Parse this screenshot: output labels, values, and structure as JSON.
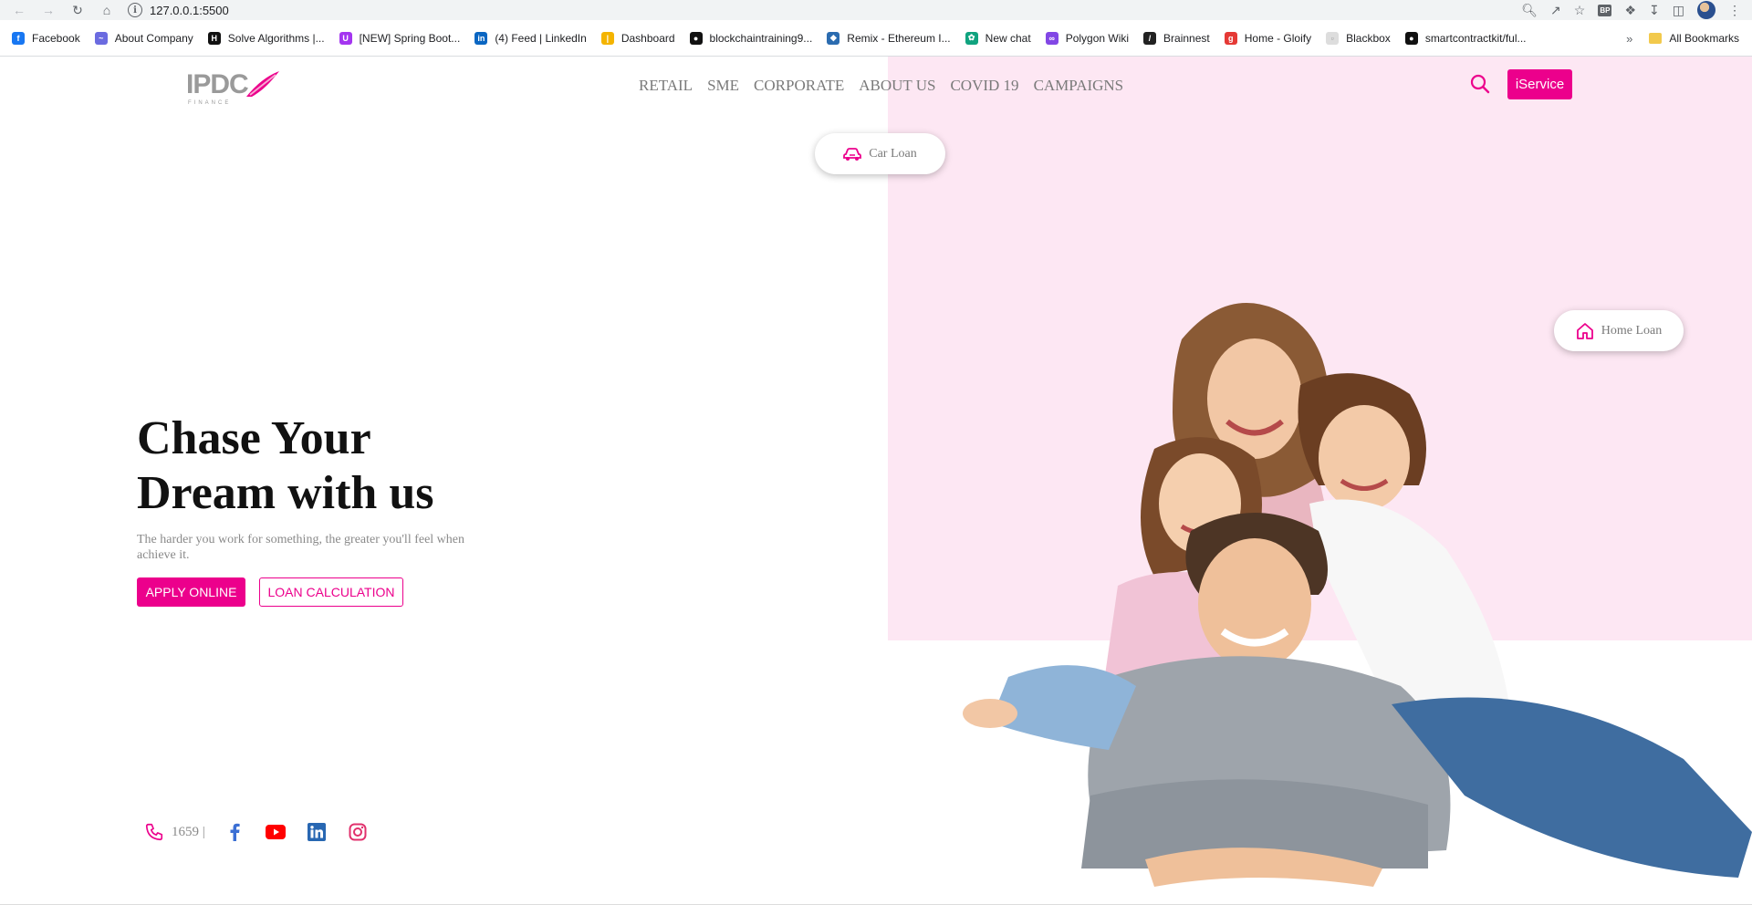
{
  "browser": {
    "url": "127.0.0.1:5500",
    "bookmarks": [
      {
        "label": "Facebook",
        "icon": "facebook-icon",
        "color": "#1877f2"
      },
      {
        "label": "About Company",
        "icon": "about-company-icon",
        "color": "#6b6be0"
      },
      {
        "label": "Solve Algorithms |...",
        "icon": "hackerrank-icon",
        "color": "#111111"
      },
      {
        "label": "[NEW] Spring Boot...",
        "icon": "udemy-icon",
        "color": "#a435f0"
      },
      {
        "label": "(4) Feed | LinkedIn",
        "icon": "linkedin-icon",
        "color": "#0a66c2"
      },
      {
        "label": "Dashboard",
        "icon": "dashboard-icon",
        "color": "#f4b400"
      },
      {
        "label": "blockchaintraining9...",
        "icon": "github-icon",
        "color": "#111111"
      },
      {
        "label": "Remix - Ethereum I...",
        "icon": "remix-icon",
        "color": "#2b6cb0"
      },
      {
        "label": "New chat",
        "icon": "chatgpt-icon",
        "color": "#10a37f"
      },
      {
        "label": "Polygon Wiki",
        "icon": "polygon-icon",
        "color": "#8247e5"
      },
      {
        "label": "Brainnest",
        "icon": "brainnest-icon",
        "color": "#222222"
      },
      {
        "label": "Home - Gloify",
        "icon": "gloify-icon",
        "color": "#e53935"
      },
      {
        "label": "Blackbox",
        "icon": "blackbox-icon",
        "color": "#dddddd"
      },
      {
        "label": "smartcontractkit/ful...",
        "icon": "github-icon",
        "color": "#111111"
      }
    ],
    "all_bookmarks": "All Bookmarks",
    "ext_badge": "BP"
  },
  "header": {
    "logo_text": "IPDC",
    "logo_sub": "FINANCE",
    "nav": [
      "RETAIL",
      "SME",
      "CORPORATE",
      "ABOUT US",
      "COVID 19",
      "CAMPAIGNS"
    ],
    "iservice_label": "iService"
  },
  "pills": {
    "car_loan": "Car Loan",
    "home_loan": "Home Loan"
  },
  "hero": {
    "title": "Chase Your Dream with us",
    "subtitle": "The harder you work for something, the greater you'll feel when achieve it.",
    "apply_label": "APPLY ONLINE",
    "calc_label": "LOAN CALCULATION"
  },
  "contact": {
    "phone": "1659 |"
  },
  "colors": {
    "brand": "#ec008c",
    "pink_bg": "#fde7f3",
    "nav_text": "#7a7a7a"
  }
}
